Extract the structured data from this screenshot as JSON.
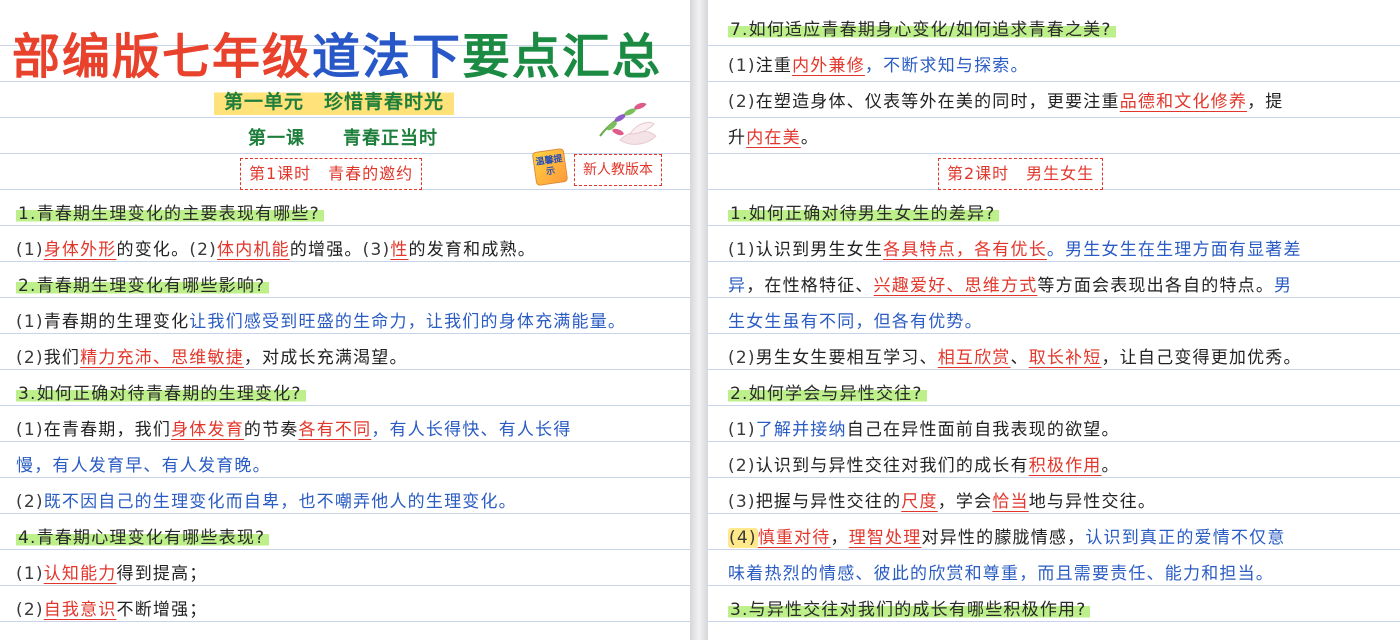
{
  "title": {
    "part1": "部编版七年级",
    "part2": "道法下",
    "part3": "要点汇总"
  },
  "unit": "第一单元　珍惜青春时光",
  "lesson": "第一课　　青春正当时",
  "left_period": "第1课时　青春的邀约",
  "badge": {
    "tip": "温馨提示",
    "edition": "新人教版本"
  },
  "right_period": "第2课时　男生女生",
  "colors": {
    "accent_red": "#e2362b",
    "accent_blue": "#2a5cc4",
    "highlight_green": "#bdf08a",
    "highlight_yellow": "#ffe98a"
  },
  "left_lines": [
    {
      "kind": "question",
      "segs": [
        {
          "t": "q",
          "v": "1.青春期生理变化的主要表现有哪些?"
        }
      ]
    },
    {
      "kind": "answer",
      "segs": [
        {
          "t": "num",
          "v": "(1)"
        },
        {
          "t": "red",
          "v": "身体外形"
        },
        {
          "t": "dark",
          "v": "的变化。"
        },
        {
          "t": "num",
          "v": "(2)"
        },
        {
          "t": "red",
          "v": "体内机能"
        },
        {
          "t": "dark",
          "v": "的增强。"
        },
        {
          "t": "num",
          "v": "(3)"
        },
        {
          "t": "red",
          "v": "性"
        },
        {
          "t": "dark",
          "v": "的发育和成熟。"
        }
      ]
    },
    {
      "kind": "question",
      "segs": [
        {
          "t": "q",
          "v": "2.青春期生理变化有哪些影响?"
        }
      ]
    },
    {
      "kind": "answer",
      "segs": [
        {
          "t": "num",
          "v": "(1)"
        },
        {
          "t": "dark",
          "v": "青春期的生理变化"
        },
        {
          "t": "blue",
          "v": "让我们感受到旺盛的生命力，让我们的身体充满能量。"
        }
      ]
    },
    {
      "kind": "answer",
      "segs": [
        {
          "t": "num",
          "v": "(2)"
        },
        {
          "t": "dark",
          "v": "我们"
        },
        {
          "t": "red",
          "v": "精力充沛、思维敏捷"
        },
        {
          "t": "dark",
          "v": "，对成长充满渴望。"
        }
      ]
    },
    {
      "kind": "question",
      "segs": [
        {
          "t": "q",
          "v": "3.如何正确对待青春期的生理变化?"
        }
      ]
    },
    {
      "kind": "answer",
      "segs": [
        {
          "t": "num",
          "v": "(1)"
        },
        {
          "t": "dark",
          "v": "在青春期，我们"
        },
        {
          "t": "red",
          "v": "身体发育"
        },
        {
          "t": "dark",
          "v": "的节奏"
        },
        {
          "t": "red",
          "v": "各有不同"
        },
        {
          "t": "blue",
          "v": "，有人长得快、有人长得"
        }
      ]
    },
    {
      "kind": "answer",
      "segs": [
        {
          "t": "blue",
          "v": "慢，有人发育早、有人发育晚。"
        }
      ]
    },
    {
      "kind": "answer",
      "segs": [
        {
          "t": "num",
          "v": "(2)"
        },
        {
          "t": "blue",
          "v": "既不因自己的生理变化而自卑，也不嘲弄他人的生理变化。"
        }
      ]
    },
    {
      "kind": "question",
      "segs": [
        {
          "t": "q",
          "v": "4.青春期心理变化有哪些表现?"
        }
      ]
    },
    {
      "kind": "answer",
      "segs": [
        {
          "t": "num",
          "v": "(1)"
        },
        {
          "t": "red",
          "v": "认知能力"
        },
        {
          "t": "dark",
          "v": "得到提高；"
        }
      ]
    },
    {
      "kind": "answer",
      "segs": [
        {
          "t": "num",
          "v": "(2)"
        },
        {
          "t": "red",
          "v": "自我意识"
        },
        {
          "t": "dark",
          "v": "不断增强；"
        }
      ]
    }
  ],
  "right_lines_top": [
    {
      "kind": "question",
      "segs": [
        {
          "t": "q",
          "v": "7.如何适应青春期身心变化/如何追求青春之美?"
        }
      ]
    },
    {
      "kind": "answer",
      "segs": [
        {
          "t": "num",
          "v": "(1)"
        },
        {
          "t": "dark",
          "v": "注重"
        },
        {
          "t": "red",
          "v": "内外兼修"
        },
        {
          "t": "blue",
          "v": "，不断求知与探索。"
        }
      ]
    },
    {
      "kind": "answer",
      "segs": [
        {
          "t": "num",
          "v": "(2)"
        },
        {
          "t": "dark",
          "v": "在塑造身体、仪表等外在美的同时，更要注重"
        },
        {
          "t": "red",
          "v": "品德和文化修养"
        },
        {
          "t": "dark",
          "v": "，提"
        }
      ]
    },
    {
      "kind": "answer",
      "segs": [
        {
          "t": "dark",
          "v": "升"
        },
        {
          "t": "red",
          "v": "内在美"
        },
        {
          "t": "dark",
          "v": "。"
        }
      ]
    }
  ],
  "right_lines_bottom": [
    {
      "kind": "question",
      "segs": [
        {
          "t": "q",
          "v": "1.如何正确对待男生女生的差异?"
        }
      ]
    },
    {
      "kind": "answer",
      "segs": [
        {
          "t": "num",
          "v": "(1)"
        },
        {
          "t": "dark",
          "v": "认识到男生女生"
        },
        {
          "t": "red",
          "v": "各具特点，各有优长"
        },
        {
          "t": "blue",
          "v": "。男生女生在生理方面有显著差"
        }
      ]
    },
    {
      "kind": "answer",
      "segs": [
        {
          "t": "blue",
          "v": "异"
        },
        {
          "t": "dark",
          "v": "，在性格特征、"
        },
        {
          "t": "red",
          "v": "兴趣爱好、思维方式"
        },
        {
          "t": "dark",
          "v": "等方面会表现出各自的特点。"
        },
        {
          "t": "blue",
          "v": "男"
        }
      ]
    },
    {
      "kind": "answer",
      "segs": [
        {
          "t": "blue",
          "v": "生女生虽有不同，但各有优势。"
        }
      ]
    },
    {
      "kind": "answer",
      "segs": [
        {
          "t": "num",
          "v": "(2)"
        },
        {
          "t": "dark",
          "v": "男生女生要相互学习、"
        },
        {
          "t": "red",
          "v": "相互欣赏"
        },
        {
          "t": "dark",
          "v": "、"
        },
        {
          "t": "red",
          "v": "取长补短"
        },
        {
          "t": "dark",
          "v": "，让自己变得更加优秀。"
        }
      ]
    },
    {
      "kind": "question",
      "segs": [
        {
          "t": "q",
          "v": "2.如何学会与异性交往?"
        }
      ]
    },
    {
      "kind": "answer",
      "segs": [
        {
          "t": "num",
          "v": "(1)"
        },
        {
          "t": "blue",
          "v": "了解并接纳"
        },
        {
          "t": "dark",
          "v": "自己在异性面前自我表现的欲望。"
        }
      ]
    },
    {
      "kind": "answer",
      "segs": [
        {
          "t": "num",
          "v": "(2)"
        },
        {
          "t": "dark",
          "v": "认识到与异性交往对我们的成长有"
        },
        {
          "t": "red",
          "v": "积极作用"
        },
        {
          "t": "dark",
          "v": "。"
        }
      ]
    },
    {
      "kind": "answer",
      "segs": [
        {
          "t": "num",
          "v": "(3)"
        },
        {
          "t": "dark",
          "v": "把握与异性交往的"
        },
        {
          "t": "red",
          "v": "尺度"
        },
        {
          "t": "dark",
          "v": "，学会"
        },
        {
          "t": "red",
          "v": "恰当"
        },
        {
          "t": "dark",
          "v": "地与异性交往。"
        }
      ]
    },
    {
      "kind": "answer",
      "segs": [
        {
          "t": "numhl",
          "v": "(4)"
        },
        {
          "t": "red",
          "v": "慎重对待"
        },
        {
          "t": "dark",
          "v": "，"
        },
        {
          "t": "red",
          "v": "理智处理"
        },
        {
          "t": "dark",
          "v": "对异性的朦胧情感，"
        },
        {
          "t": "blue",
          "v": "认识到真正的爱情不仅意"
        }
      ]
    },
    {
      "kind": "answer",
      "segs": [
        {
          "t": "blue",
          "v": "味着热烈的情感、彼此的欣赏和尊重，而且需要责任、能力和担当。"
        }
      ]
    },
    {
      "kind": "question",
      "segs": [
        {
          "t": "q",
          "v": "3.与异性交往对我们的成长有哪些积极作用?"
        }
      ]
    }
  ]
}
